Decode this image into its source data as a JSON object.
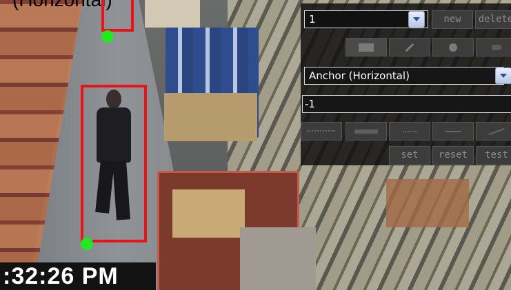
{
  "overlay": {
    "top_label": "(Horizontal)",
    "timestamp": ":32:26 PM"
  },
  "panel": {
    "region_select": {
      "value": "1"
    },
    "new_label": "new",
    "delete_label": "delete",
    "tools": [
      "rectangle-tool-icon",
      "pencil-tool-icon",
      "point-tool-icon",
      "trash-tool-icon"
    ],
    "anchor_select": {
      "value": "Anchor (Horizontal)"
    },
    "value_field": "-1",
    "line_styles": [
      "dotted-line-icon",
      "solid-bar-icon",
      "dotted-short-icon",
      "arrow-line-icon",
      "slope-line-icon"
    ],
    "set_label": "set",
    "reset_label": "reset",
    "test_label": "test"
  },
  "colors": {
    "bbox": "#e8141b",
    "anchor_point": "#22e81f",
    "panel_bg": "#121212"
  }
}
